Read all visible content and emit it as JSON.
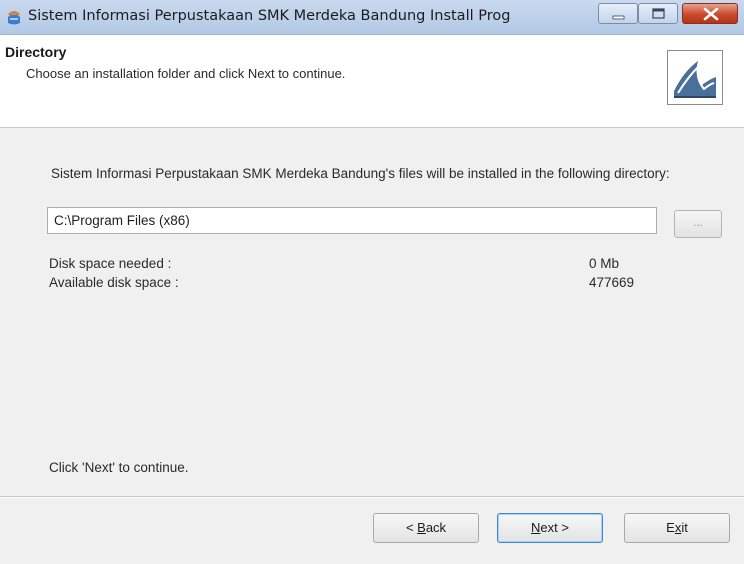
{
  "window": {
    "title": "Sistem Informasi Perpustakaan SMK Merdeka Bandung Install Prog"
  },
  "header": {
    "title": "Directory",
    "subtitle": "Choose an installation folder and click Next to continue."
  },
  "body": {
    "description": "Sistem Informasi Perpustakaan SMK Merdeka Bandung's files will be installed in the following directory:",
    "directory_value": "C:\\Program Files (x86)",
    "browse_label": "...",
    "disk_space_needed_label": "Disk space needed :",
    "disk_space_needed_value": "0 Mb",
    "available_disk_space_label": "Available disk space :",
    "available_disk_space_value": "477669",
    "footer_note": "Click 'Next' to continue."
  },
  "buttons": {
    "back": {
      "prefix": "< ",
      "mnemonic": "B",
      "rest": "ack"
    },
    "next": {
      "prefix": "",
      "mnemonic": "N",
      "rest": "ext >"
    },
    "exit": {
      "prefix": "E",
      "mnemonic": "x",
      "rest": "it"
    }
  },
  "icons": {
    "app": "installer-app-icon",
    "minimize": "minimize-icon",
    "maximize": "maximize-icon",
    "close": "close-icon",
    "header_logo": "installer-logo-icon"
  },
  "colors": {
    "titlebar": "#b3c9e6",
    "close_button": "#c94a2e",
    "default_button_border": "#3c8ad6"
  }
}
